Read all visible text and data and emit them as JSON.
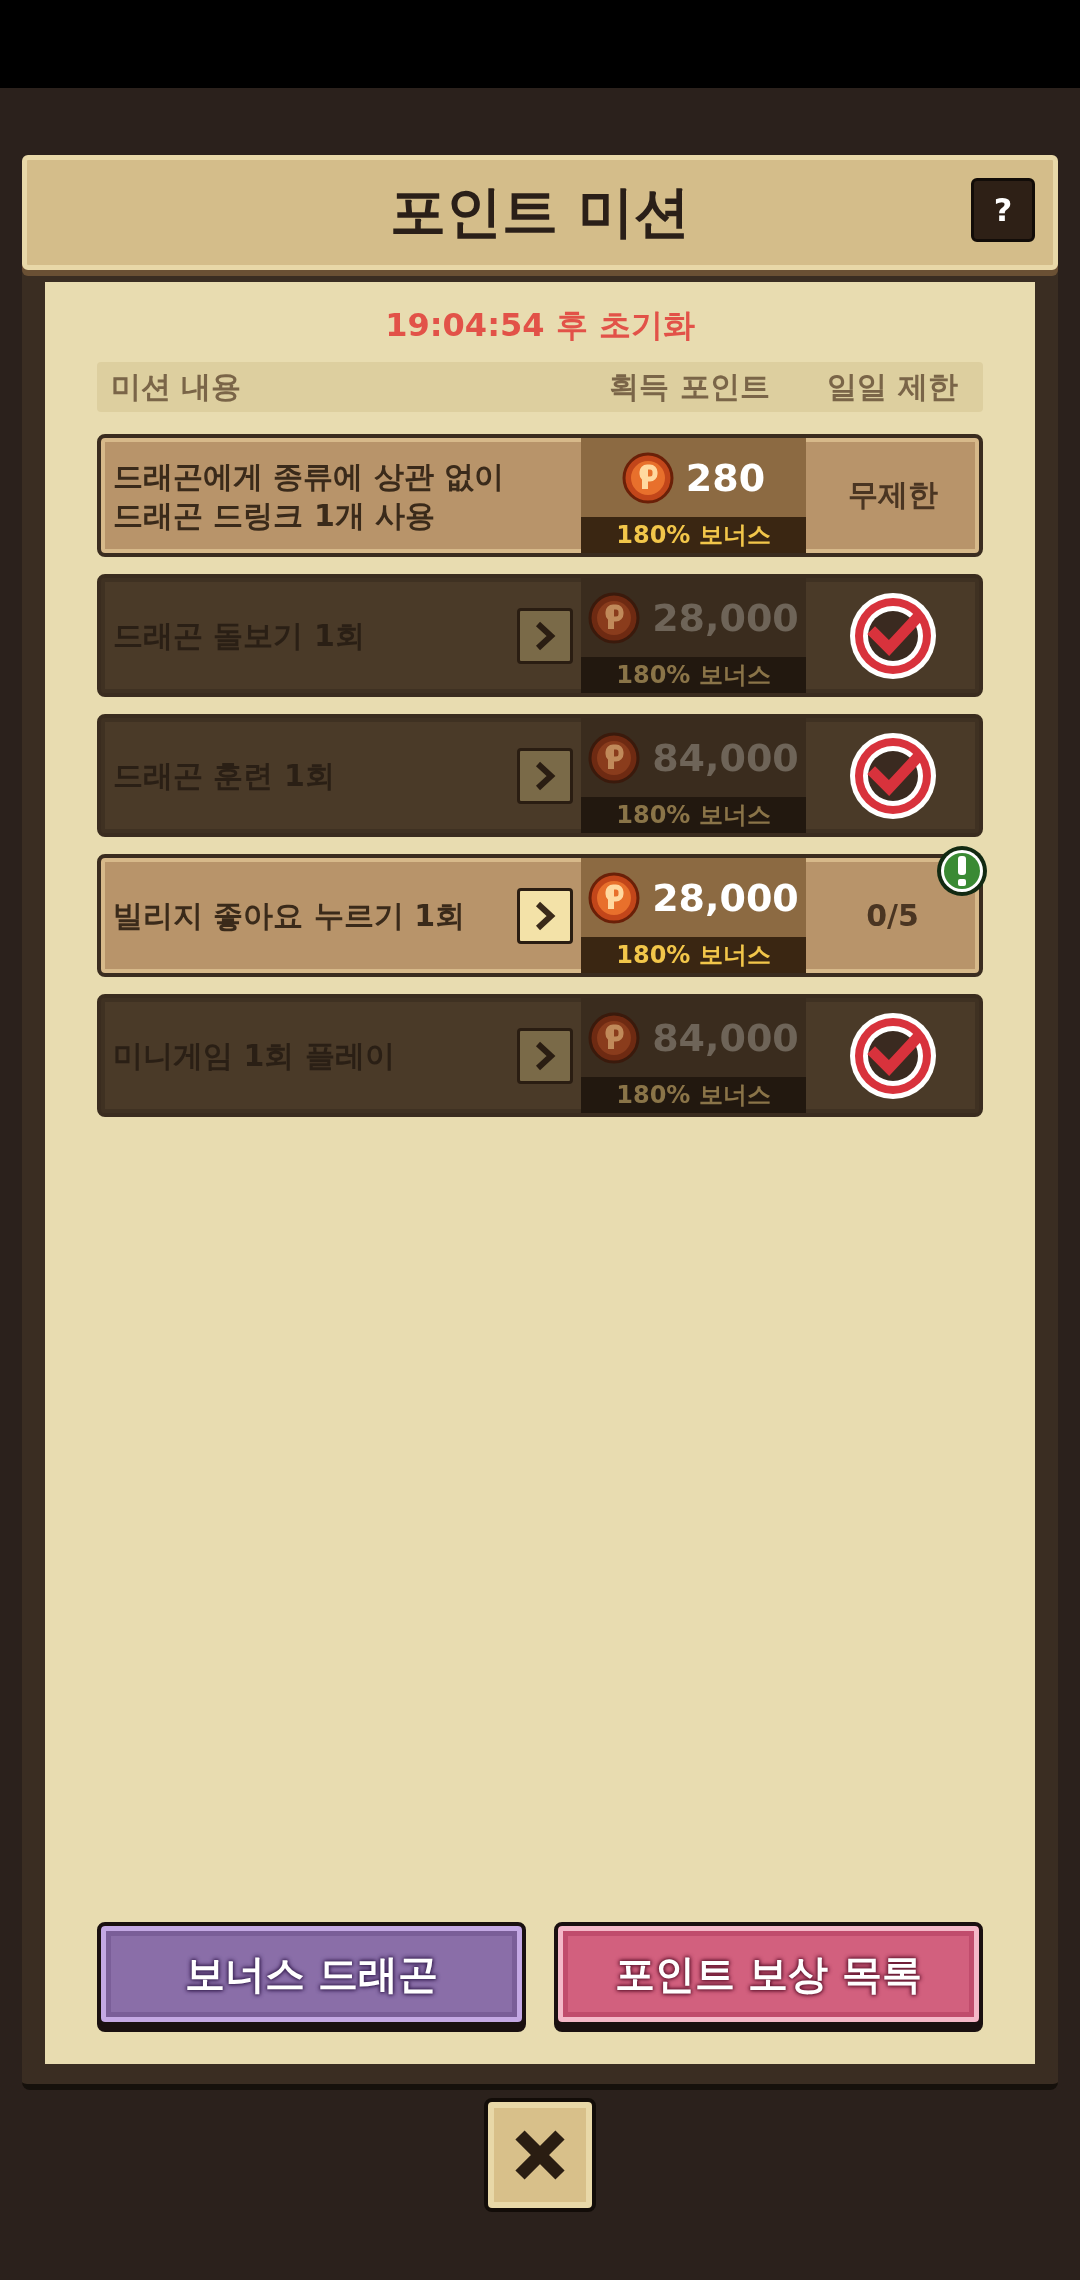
{
  "title": "포인트 미션",
  "help_button": "?",
  "timer": "19:04:54 후 초기화",
  "columns": [
    "미션 내용",
    "획득 포인트",
    "일일 제한"
  ],
  "missions": [
    {
      "text": "드래곤에게 종류에 상관 없이\n드래곤 드링크 1개 사용",
      "shortcut": false,
      "points": "280",
      "bonus": "180% 보너스",
      "completed": false,
      "limit": "무제한",
      "alert": false
    },
    {
      "text": "드래곤 돌보기 1회",
      "shortcut": true,
      "points": "28,000",
      "bonus": "180% 보너스",
      "completed": true,
      "alert": false
    },
    {
      "text": "드래곤 훈련 1회",
      "shortcut": true,
      "points": "84,000",
      "bonus": "180% 보너스",
      "completed": true,
      "alert": false
    },
    {
      "text": "빌리지 좋아요 누르기 1회",
      "shortcut": true,
      "points": "28,000",
      "bonus": "180% 보너스",
      "completed": false,
      "limit": "0/5",
      "alert": true
    },
    {
      "text": "미니게임 1회 플레이",
      "shortcut": true,
      "points": "84,000",
      "bonus": "180% 보너스",
      "completed": true,
      "alert": false
    }
  ],
  "buttons": [
    {
      "label": "보너스 드래곤",
      "kind": "purple"
    },
    {
      "label": "포인트 보상 목록",
      "kind": "pink"
    }
  ]
}
